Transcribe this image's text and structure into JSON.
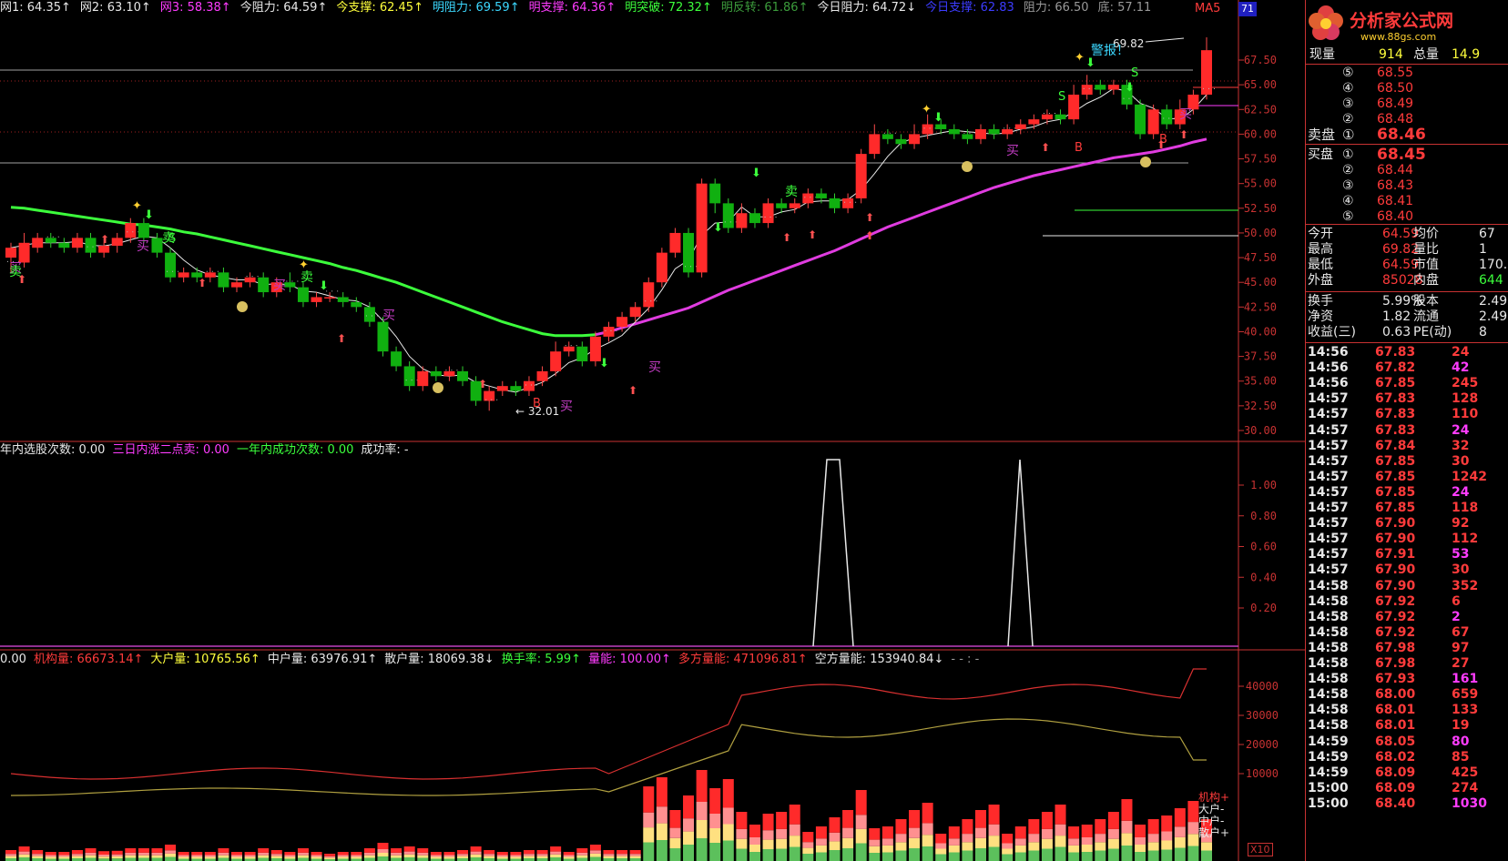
{
  "top_indicators": [
    {
      "label": "网1",
      "value": "64.35",
      "arrow": "↑",
      "color": "#e8e8e8"
    },
    {
      "label": "网2",
      "value": "63.10",
      "arrow": "↑",
      "color": "#e8e8e8"
    },
    {
      "label": "网3",
      "value": "58.38",
      "arrow": "↑",
      "color": "#ff3cff"
    },
    {
      "label": "今阻力",
      "value": "64.59",
      "arrow": "↑",
      "color": "#e8e8e8"
    },
    {
      "label": "今支撑",
      "value": "62.45",
      "arrow": "↑",
      "color": "#ffff3c"
    },
    {
      "label": "明阻力",
      "value": "69.59",
      "arrow": "↑",
      "color": "#3cd8ff"
    },
    {
      "label": "明支撑",
      "value": "64.36",
      "arrow": "↑",
      "color": "#ff3cff"
    },
    {
      "label": "明突破",
      "value": "72.32",
      "arrow": "↑",
      "color": "#3cff3c"
    },
    {
      "label": "明反转",
      "value": "61.86",
      "arrow": "↑",
      "color": "#3c9c3c"
    },
    {
      "label": "今日阻力",
      "value": "64.72",
      "arrow": "↓",
      "color": "#e8e8e8"
    },
    {
      "label": "今日支撑",
      "value": "62.83",
      "arrow": "",
      "color": "#3c3cff"
    },
    {
      "label": "阻力",
      "value": "66.50",
      "arrow": "",
      "color": "#999999"
    },
    {
      "label": "底",
      "value": "57.11",
      "arrow": "",
      "color": "#999999"
    }
  ],
  "ma_label": "MA5",
  "corner_badge": "71",
  "main_axis": [
    "67.50",
    "65.00",
    "62.50",
    "60.00",
    "57.50",
    "55.00",
    "52.50",
    "50.00",
    "47.50",
    "45.00",
    "42.50",
    "40.00",
    "37.50",
    "35.00",
    "32.50",
    "30.00"
  ],
  "annotations": {
    "high": "69.82",
    "low": "32.01",
    "alert": "警报！",
    "buy": "买",
    "sell": "卖",
    "s": "S",
    "b": "B"
  },
  "mid_bar": [
    {
      "text": "年内选股次数: 0.00",
      "color": "#e8e8e8"
    },
    {
      "text": "三日内涨二点卖: 0.00",
      "color": "#ff3cff"
    },
    {
      "text": "一年内成功次数: 0.00",
      "color": "#3cff3c"
    },
    {
      "text": "成功率: -",
      "color": "#e8e8e8"
    }
  ],
  "mid_axis": [
    "1.00",
    "0.80",
    "0.60",
    "0.40",
    "0.20"
  ],
  "low_bar": [
    {
      "text": "0.00",
      "color": "#e8e8e8"
    },
    {
      "text": "机构量: 66673.14↑",
      "color": "#ff3b3b"
    },
    {
      "text": "大户量: 10765.56↑",
      "color": "#ffff3c"
    },
    {
      "text": "中户量: 63976.91↑",
      "color": "#e8e8e8"
    },
    {
      "text": "散户量: 18069.38↓",
      "color": "#e8e8e8"
    },
    {
      "text": "换手率: 5.99↑",
      "color": "#3cff3c"
    },
    {
      "text": "量能: 100.00↑",
      "color": "#ff3cff"
    },
    {
      "text": "多方量能: 471096.81↑",
      "color": "#ff3b3b"
    },
    {
      "text": "空方量能: 153940.84↓",
      "color": "#e8e8e8"
    },
    {
      "text": "- - : -",
      "color": "#999999"
    }
  ],
  "low_axis": [
    "40000",
    "30000",
    "20000",
    "10000"
  ],
  "low_legend": [
    "机构+",
    "大户-",
    "中户-",
    "散户+"
  ],
  "x10": "X10",
  "panel": {
    "logo_text": "分析家公式网",
    "logo_url": "www.88gs.com",
    "now_vol_label": "现量",
    "now_vol": "914",
    "total_vol_label": "总量",
    "total_vol": "14.9",
    "sell_label": "卖盘",
    "buy_label": "买盘",
    "sells": [
      {
        "n": "⑤",
        "price": "68.55"
      },
      {
        "n": "④",
        "price": "68.50"
      },
      {
        "n": "③",
        "price": "68.49"
      },
      {
        "n": "②",
        "price": "68.48"
      },
      {
        "n": "①",
        "price": "68.46"
      }
    ],
    "buys": [
      {
        "n": "①",
        "price": "68.45"
      },
      {
        "n": "②",
        "price": "68.44"
      },
      {
        "n": "③",
        "price": "68.43"
      },
      {
        "n": "④",
        "price": "68.41"
      },
      {
        "n": "⑤",
        "price": "68.40"
      }
    ],
    "stats": [
      {
        "l1": "今开",
        "v1": "64.59",
        "l2": "均价",
        "v2": "67"
      },
      {
        "l1": "最高",
        "v1": "69.82",
        "l2": "量比",
        "v2": "1"
      },
      {
        "l1": "最低",
        "v1": "64.59",
        "l2": "市值",
        "v2": "170.2"
      },
      {
        "l1": "外盘",
        "v1": "85028",
        "l2": "内盘",
        "v2": "644"
      }
    ],
    "stats2": [
      {
        "l1": "换手",
        "v1": "5.99%",
        "l2": "股本",
        "v2": "2.49"
      },
      {
        "l1": "净资",
        "v1": "1.82",
        "l2": "流通",
        "v2": "2.49"
      },
      {
        "l1": "收益(三)",
        "v1": "0.63",
        "l2": "PE(动)",
        "v2": "8"
      }
    ],
    "ticks": [
      {
        "t": "14:56",
        "p": "67.83",
        "v": "24"
      },
      {
        "t": "14:56",
        "p": "67.82",
        "v": "42"
      },
      {
        "t": "14:56",
        "p": "67.85",
        "v": "245"
      },
      {
        "t": "14:57",
        "p": "67.83",
        "v": "128"
      },
      {
        "t": "14:57",
        "p": "67.83",
        "v": "110"
      },
      {
        "t": "14:57",
        "p": "67.83",
        "v": "24"
      },
      {
        "t": "14:57",
        "p": "67.84",
        "v": "32"
      },
      {
        "t": "14:57",
        "p": "67.85",
        "v": "30"
      },
      {
        "t": "14:57",
        "p": "67.85",
        "v": "1242"
      },
      {
        "t": "14:57",
        "p": "67.85",
        "v": "24"
      },
      {
        "t": "14:57",
        "p": "67.85",
        "v": "118"
      },
      {
        "t": "14:57",
        "p": "67.90",
        "v": "92"
      },
      {
        "t": "14:57",
        "p": "67.90",
        "v": "112"
      },
      {
        "t": "14:57",
        "p": "67.91",
        "v": "53"
      },
      {
        "t": "14:57",
        "p": "67.90",
        "v": "30"
      },
      {
        "t": "14:58",
        "p": "67.90",
        "v": "352"
      },
      {
        "t": "14:58",
        "p": "67.92",
        "v": "6"
      },
      {
        "t": "14:58",
        "p": "67.92",
        "v": "2"
      },
      {
        "t": "14:58",
        "p": "67.92",
        "v": "67"
      },
      {
        "t": "14:58",
        "p": "67.98",
        "v": "97"
      },
      {
        "t": "14:58",
        "p": "67.98",
        "v": "27"
      },
      {
        "t": "14:58",
        "p": "67.93",
        "v": "161"
      },
      {
        "t": "14:58",
        "p": "68.00",
        "v": "659"
      },
      {
        "t": "14:58",
        "p": "68.01",
        "v": "133"
      },
      {
        "t": "14:58",
        "p": "68.01",
        "v": "19"
      },
      {
        "t": "14:59",
        "p": "68.05",
        "v": "80"
      },
      {
        "t": "14:59",
        "p": "68.02",
        "v": "85"
      },
      {
        "t": "14:59",
        "p": "68.09",
        "v": "425"
      },
      {
        "t": "15:00",
        "p": "68.09",
        "v": "274"
      },
      {
        "t": "15:00",
        "p": "68.40",
        "v": "1030"
      }
    ]
  },
  "chart_data": {
    "type": "candlestick",
    "ylim": [
      30,
      70
    ],
    "candles": [
      [
        47.5,
        48.5,
        49,
        46
      ],
      [
        47,
        49,
        50,
        46.5
      ],
      [
        48.5,
        49.5,
        50,
        48
      ],
      [
        49.5,
        49,
        50,
        48.5
      ],
      [
        49,
        48.5,
        49.5,
        48
      ],
      [
        48.5,
        49.5,
        50,
        48
      ],
      [
        49.5,
        48,
        50,
        47.5
      ],
      [
        48,
        48.7,
        49,
        47.5
      ],
      [
        48.7,
        49.5,
        50,
        48
      ],
      [
        49.5,
        51,
        51.5,
        49
      ],
      [
        51,
        49.5,
        51.5,
        49
      ],
      [
        49.5,
        48,
        50,
        47.5
      ],
      [
        48,
        45.5,
        48.5,
        45
      ],
      [
        45.5,
        46,
        46.5,
        45
      ],
      [
        46,
        45.5,
        46.5,
        45
      ],
      [
        45.5,
        46,
        46.5,
        45
      ],
      [
        46,
        44.5,
        46.5,
        44
      ],
      [
        44.5,
        45,
        45.5,
        44
      ],
      [
        45,
        45.5,
        46,
        44.5
      ],
      [
        45.5,
        44,
        46,
        43.5
      ],
      [
        44,
        45,
        45.5,
        43.5
      ],
      [
        45,
        44.5,
        46,
        44
      ],
      [
        44.5,
        43,
        45,
        42.5
      ],
      [
        43,
        43.5,
        44,
        42.5
      ],
      [
        43.5,
        43.5,
        44,
        43
      ],
      [
        43.5,
        43,
        44,
        42.5
      ],
      [
        43,
        42.5,
        43.5,
        42
      ],
      [
        42.5,
        41,
        43,
        40.5
      ],
      [
        41,
        38,
        41.5,
        37.5
      ],
      [
        38,
        36.5,
        38.5,
        36
      ],
      [
        36.5,
        34.5,
        37,
        34
      ],
      [
        34.5,
        36,
        36.5,
        34
      ],
      [
        36,
        35.5,
        36.5,
        35
      ],
      [
        35.5,
        36,
        36.5,
        35
      ],
      [
        36,
        35,
        36.5,
        34.5
      ],
      [
        35,
        33,
        35.5,
        32.5
      ],
      [
        33,
        34,
        34.5,
        32
      ],
      [
        34,
        34.5,
        35,
        33.5
      ],
      [
        34.5,
        34,
        35,
        33.5
      ],
      [
        34,
        35,
        35.5,
        33.5
      ],
      [
        35,
        36,
        36.5,
        34.5
      ],
      [
        36,
        38,
        39,
        35.5
      ],
      [
        38,
        38.5,
        39,
        37.5
      ],
      [
        38.5,
        37,
        39,
        36.5
      ],
      [
        37,
        39.5,
        40,
        36.5
      ],
      [
        39.5,
        40.5,
        41,
        39
      ],
      [
        40.5,
        41.5,
        42,
        40
      ],
      [
        41.5,
        42.5,
        43,
        41
      ],
      [
        42.5,
        45,
        45.5,
        42
      ],
      [
        45,
        48,
        48.5,
        44.5
      ],
      [
        48,
        50,
        50.5,
        47.5
      ],
      [
        50,
        46,
        50.5,
        45.5
      ],
      [
        46,
        55,
        55.5,
        45.5
      ],
      [
        55,
        53,
        55.5,
        52
      ],
      [
        53,
        50.5,
        53.5,
        50
      ],
      [
        50.5,
        52,
        53,
        50
      ],
      [
        52,
        51,
        52.5,
        50.5
      ],
      [
        51,
        53,
        53.5,
        50.5
      ],
      [
        53,
        52.5,
        53.5,
        52
      ],
      [
        52.5,
        53,
        53.5,
        52
      ],
      [
        53,
        54,
        54.5,
        52.5
      ],
      [
        54,
        53.5,
        54.5,
        53
      ],
      [
        53.5,
        52.5,
        54,
        52
      ],
      [
        52.5,
        53.5,
        54,
        52
      ],
      [
        53.5,
        58,
        58.5,
        53
      ],
      [
        58,
        60,
        61,
        57.5
      ],
      [
        60,
        59.5,
        60.5,
        59
      ],
      [
        59.5,
        59,
        60,
        58.5
      ],
      [
        59,
        60,
        61,
        58.5
      ],
      [
        60,
        61,
        62,
        59.5
      ],
      [
        61,
        60.5,
        61.5,
        60
      ],
      [
        60.5,
        60,
        61,
        59.5
      ],
      [
        60,
        59.5,
        60.5,
        59
      ],
      [
        59.5,
        60.5,
        61,
        59
      ],
      [
        60.5,
        60,
        61,
        59.5
      ],
      [
        60,
        60.5,
        61,
        59.5
      ],
      [
        60.5,
        61,
        61.5,
        60
      ],
      [
        61,
        61.5,
        62,
        60.5
      ],
      [
        61.5,
        62,
        62.5,
        61
      ],
      [
        62,
        61.5,
        62.5,
        61
      ],
      [
        61.5,
        64,
        65,
        61
      ],
      [
        64,
        65,
        66,
        63.5
      ],
      [
        65,
        64.5,
        65.5,
        64
      ],
      [
        64.5,
        65,
        65.5,
        64
      ],
      [
        65,
        63,
        65.5,
        62.5
      ],
      [
        63,
        60,
        63.5,
        59.5
      ],
      [
        60,
        62.5,
        63,
        59.5
      ],
      [
        62.5,
        61,
        63,
        60.5
      ],
      [
        61,
        62.5,
        63.5,
        60.5
      ],
      [
        62.5,
        64,
        64.5,
        62
      ],
      [
        64,
        68.5,
        69.8,
        63.5
      ]
    ],
    "ma_long": [
      52.6,
      52.5,
      52.3,
      52.1,
      51.9,
      51.7,
      51.5,
      51.3,
      51.1,
      50.9,
      50.8,
      50.6,
      50.4,
      50.1,
      49.9,
      49.6,
      49.3,
      49,
      48.7,
      48.4,
      48.1,
      47.8,
      47.5,
      47.2,
      46.9,
      46.5,
      46.2,
      45.8,
      45.4,
      45,
      44.5,
      44,
      43.5,
      43,
      42.5,
      42,
      41.5,
      41,
      40.6,
      40.2,
      39.8,
      39.6,
      39.6,
      39.6,
      39.7,
      40,
      40.4,
      40.8,
      41.2,
      41.6,
      42,
      42.4,
      43,
      43.6,
      44.2,
      44.7,
      45.2,
      45.7,
      46.2,
      46.7,
      47.2,
      47.7,
      48.2,
      48.8,
      49.4,
      50,
      50.6,
      51.1,
      51.6,
      52.1,
      52.6,
      53.1,
      53.6,
      54.1,
      54.6,
      55,
      55.4,
      55.8,
      56.1,
      56.4,
      56.7,
      57,
      57.3,
      57.6,
      57.8,
      58,
      58.2,
      58.5,
      58.8,
      59.2,
      59.5
    ]
  }
}
